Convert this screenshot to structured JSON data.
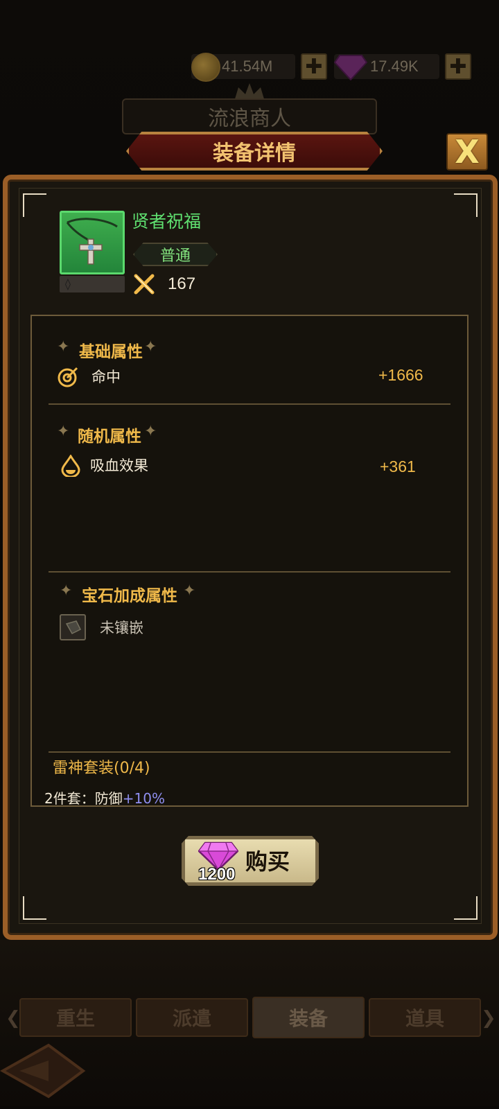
{
  "currency": {
    "gold": "41.54M",
    "gems": "17.49K",
    "plus_label": "✚"
  },
  "shop": {
    "title": "流浪商人"
  },
  "dialog": {
    "title": "装备详情",
    "close_label": "X"
  },
  "item": {
    "name": "贤者祝福",
    "rarity": "普通",
    "slot_symbol": "◊",
    "power": "167"
  },
  "base_attributes": {
    "title": "基础属性",
    "stats": [
      {
        "label": "命中",
        "value": "+1666"
      }
    ]
  },
  "random_attributes": {
    "title": "随机属性",
    "stats": [
      {
        "label": "吸血效果",
        "value": "+361"
      }
    ]
  },
  "gem_attributes": {
    "title": "宝石加成属性",
    "status": "未镶嵌"
  },
  "set": {
    "title": "雷神套装(0/4)",
    "bonus_label": "2件套：防御",
    "bonus_value": "+10%"
  },
  "buy": {
    "price": "1200",
    "label": "购买"
  },
  "nav": {
    "tabs": [
      "重生",
      "派遣",
      "装备",
      "道具"
    ],
    "active": "装备"
  },
  "colors": {
    "accent_gold": "#f0b94a",
    "item_green": "#5fe070",
    "bonus_blue": "#8f8ff0",
    "panel_border": "#9b5e27"
  }
}
